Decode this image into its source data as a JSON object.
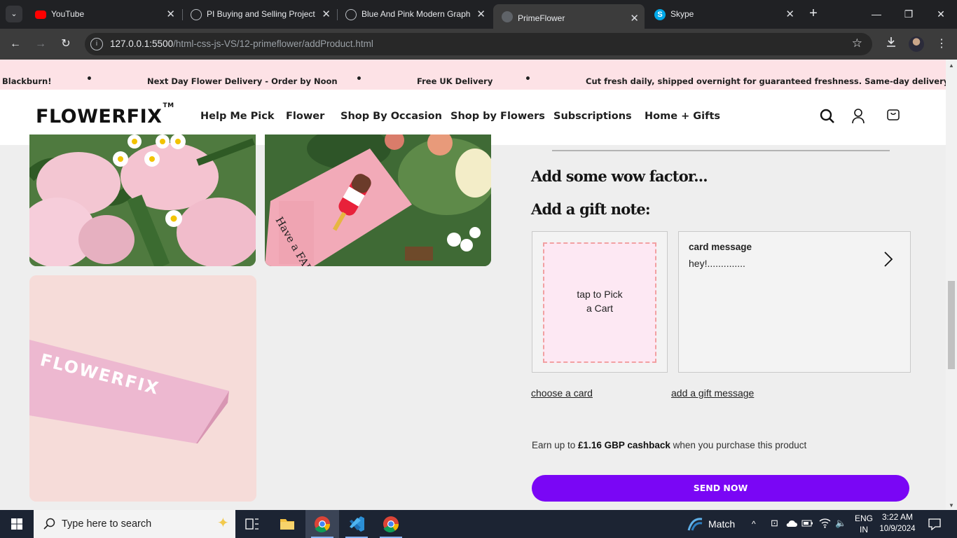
{
  "browser": {
    "tabs": [
      {
        "title": "YouTube",
        "icon": "youtube-icon",
        "active": false
      },
      {
        "title": "PI Buying and Selling Project",
        "icon": "globe-icon",
        "active": false
      },
      {
        "title": "Blue And Pink Modern Graphic",
        "icon": "globe-icon",
        "active": false
      },
      {
        "title": "PrimeFlower",
        "icon": "globe-icon",
        "active": true
      },
      {
        "title": "Skype",
        "icon": "skype-icon",
        "active": false
      }
    ],
    "url_host": "127.0.0.1:5500",
    "url_path": "/html-css-js-VS/12-primeflower/addProduct.html"
  },
  "page": {
    "announcements": [
      "Blackburn!",
      "Next Day Flower Delivery - Order by Noon",
      "Free UK Delivery",
      "Cut fresh daily, shipped overnight for guaranteed freshness. Same-day delivery in Blackburn!"
    ],
    "logo": "FLOWERFIX",
    "logo_tm": "TM",
    "nav": [
      "Help Me Pick",
      "Flower",
      "Shop By Occasion",
      "Shop by Flowers",
      "Subscriptions",
      "Home + Gifts"
    ],
    "wow_heading": "Add some wow factor...",
    "gift_note_heading": "Add a gift note:",
    "card_pick_line1": "tap to Pick",
    "card_pick_line2": "a Cart",
    "card_message_label": "card message",
    "card_message_text": "hey!..............",
    "choose_card_link": "choose a card",
    "gift_message_link": "add a gift message",
    "cashback_prefix": "Earn up to ",
    "cashback_amount": "£1.16 GBP cashback",
    "cashback_suffix": " when you purchase this product",
    "send_button": "SEND NOW",
    "packaging_text": "FLOWERFIX",
    "card_handwriting": "Have a FAB ..."
  },
  "taskbar": {
    "search_placeholder": "Type here to search",
    "weather_label": "Match",
    "lang_line1": "ENG",
    "lang_line2": "IN",
    "time": "3:22 AM",
    "date": "10/9/2024"
  },
  "colors": {
    "accent": "#7a06f5",
    "announcement_bg": "#fde2e6",
    "card_pick_border": "#f2a0a2",
    "card_pick_bg": "#fde8f3"
  }
}
